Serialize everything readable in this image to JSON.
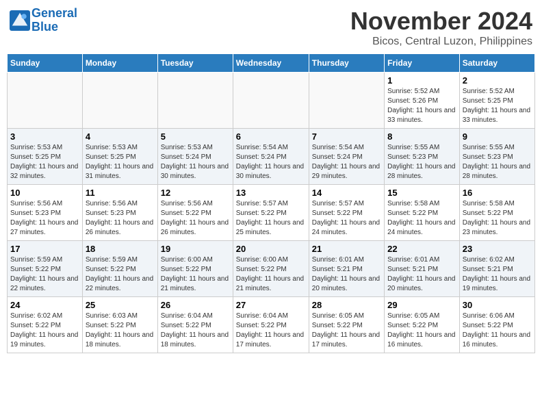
{
  "header": {
    "logo_line1": "General",
    "logo_line2": "Blue",
    "month_title": "November 2024",
    "location": "Bicos, Central Luzon, Philippines"
  },
  "days_of_week": [
    "Sunday",
    "Monday",
    "Tuesday",
    "Wednesday",
    "Thursday",
    "Friday",
    "Saturday"
  ],
  "weeks": [
    [
      {
        "day": "",
        "info": ""
      },
      {
        "day": "",
        "info": ""
      },
      {
        "day": "",
        "info": ""
      },
      {
        "day": "",
        "info": ""
      },
      {
        "day": "",
        "info": ""
      },
      {
        "day": "1",
        "info": "Sunrise: 5:52 AM\nSunset: 5:26 PM\nDaylight: 11 hours and 33 minutes."
      },
      {
        "day": "2",
        "info": "Sunrise: 5:52 AM\nSunset: 5:25 PM\nDaylight: 11 hours and 33 minutes."
      }
    ],
    [
      {
        "day": "3",
        "info": "Sunrise: 5:53 AM\nSunset: 5:25 PM\nDaylight: 11 hours and 32 minutes."
      },
      {
        "day": "4",
        "info": "Sunrise: 5:53 AM\nSunset: 5:25 PM\nDaylight: 11 hours and 31 minutes."
      },
      {
        "day": "5",
        "info": "Sunrise: 5:53 AM\nSunset: 5:24 PM\nDaylight: 11 hours and 30 minutes."
      },
      {
        "day": "6",
        "info": "Sunrise: 5:54 AM\nSunset: 5:24 PM\nDaylight: 11 hours and 30 minutes."
      },
      {
        "day": "7",
        "info": "Sunrise: 5:54 AM\nSunset: 5:24 PM\nDaylight: 11 hours and 29 minutes."
      },
      {
        "day": "8",
        "info": "Sunrise: 5:55 AM\nSunset: 5:23 PM\nDaylight: 11 hours and 28 minutes."
      },
      {
        "day": "9",
        "info": "Sunrise: 5:55 AM\nSunset: 5:23 PM\nDaylight: 11 hours and 28 minutes."
      }
    ],
    [
      {
        "day": "10",
        "info": "Sunrise: 5:56 AM\nSunset: 5:23 PM\nDaylight: 11 hours and 27 minutes."
      },
      {
        "day": "11",
        "info": "Sunrise: 5:56 AM\nSunset: 5:23 PM\nDaylight: 11 hours and 26 minutes."
      },
      {
        "day": "12",
        "info": "Sunrise: 5:56 AM\nSunset: 5:22 PM\nDaylight: 11 hours and 26 minutes."
      },
      {
        "day": "13",
        "info": "Sunrise: 5:57 AM\nSunset: 5:22 PM\nDaylight: 11 hours and 25 minutes."
      },
      {
        "day": "14",
        "info": "Sunrise: 5:57 AM\nSunset: 5:22 PM\nDaylight: 11 hours and 24 minutes."
      },
      {
        "day": "15",
        "info": "Sunrise: 5:58 AM\nSunset: 5:22 PM\nDaylight: 11 hours and 24 minutes."
      },
      {
        "day": "16",
        "info": "Sunrise: 5:58 AM\nSunset: 5:22 PM\nDaylight: 11 hours and 23 minutes."
      }
    ],
    [
      {
        "day": "17",
        "info": "Sunrise: 5:59 AM\nSunset: 5:22 PM\nDaylight: 11 hours and 22 minutes."
      },
      {
        "day": "18",
        "info": "Sunrise: 5:59 AM\nSunset: 5:22 PM\nDaylight: 11 hours and 22 minutes."
      },
      {
        "day": "19",
        "info": "Sunrise: 6:00 AM\nSunset: 5:22 PM\nDaylight: 11 hours and 21 minutes."
      },
      {
        "day": "20",
        "info": "Sunrise: 6:00 AM\nSunset: 5:22 PM\nDaylight: 11 hours and 21 minutes."
      },
      {
        "day": "21",
        "info": "Sunrise: 6:01 AM\nSunset: 5:21 PM\nDaylight: 11 hours and 20 minutes."
      },
      {
        "day": "22",
        "info": "Sunrise: 6:01 AM\nSunset: 5:21 PM\nDaylight: 11 hours and 20 minutes."
      },
      {
        "day": "23",
        "info": "Sunrise: 6:02 AM\nSunset: 5:21 PM\nDaylight: 11 hours and 19 minutes."
      }
    ],
    [
      {
        "day": "24",
        "info": "Sunrise: 6:02 AM\nSunset: 5:22 PM\nDaylight: 11 hours and 19 minutes."
      },
      {
        "day": "25",
        "info": "Sunrise: 6:03 AM\nSunset: 5:22 PM\nDaylight: 11 hours and 18 minutes."
      },
      {
        "day": "26",
        "info": "Sunrise: 6:04 AM\nSunset: 5:22 PM\nDaylight: 11 hours and 18 minutes."
      },
      {
        "day": "27",
        "info": "Sunrise: 6:04 AM\nSunset: 5:22 PM\nDaylight: 11 hours and 17 minutes."
      },
      {
        "day": "28",
        "info": "Sunrise: 6:05 AM\nSunset: 5:22 PM\nDaylight: 11 hours and 17 minutes."
      },
      {
        "day": "29",
        "info": "Sunrise: 6:05 AM\nSunset: 5:22 PM\nDaylight: 11 hours and 16 minutes."
      },
      {
        "day": "30",
        "info": "Sunrise: 6:06 AM\nSunset: 5:22 PM\nDaylight: 11 hours and 16 minutes."
      }
    ]
  ]
}
